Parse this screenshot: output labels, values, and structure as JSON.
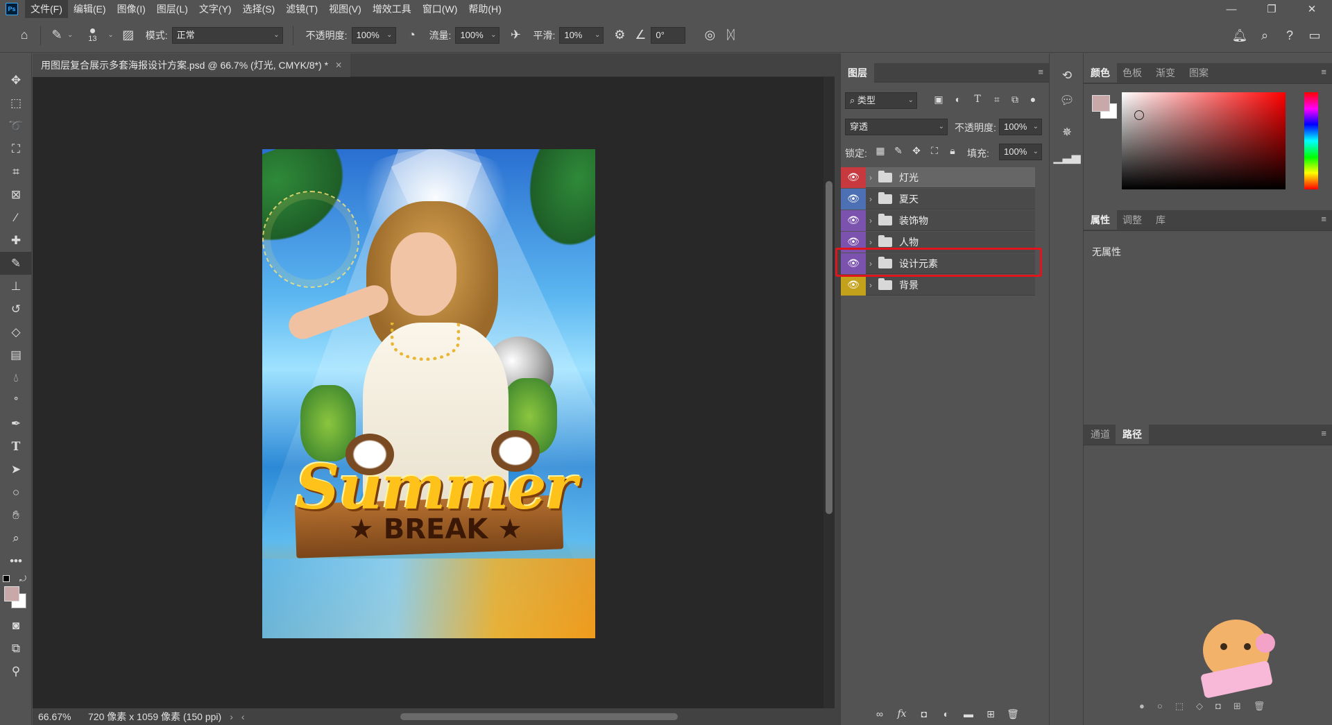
{
  "app": {
    "logo": "Ps"
  },
  "menubar": {
    "items": [
      "文件(F)",
      "编辑(E)",
      "图像(I)",
      "图层(L)",
      "文字(Y)",
      "选择(S)",
      "滤镜(T)",
      "视图(V)",
      "增效工具",
      "窗口(W)",
      "帮助(H)"
    ]
  },
  "options": {
    "brush_size": "13",
    "mode_label": "模式:",
    "mode_value": "正常",
    "opacity_label": "不透明度:",
    "opacity_value": "100%",
    "flow_label": "流量:",
    "flow_value": "100%",
    "smooth_label": "平滑:",
    "smooth_value": "10%",
    "angle_value": "0°"
  },
  "document": {
    "tab_title": "用图层复合展示多套海报设计方案.psd @ 66.7% (灯光, CMYK/8*) *",
    "zoom": "66.67%",
    "doc_info": "720 像素 x 1059 像素 (150 ppi)"
  },
  "poster": {
    "title": "Summer",
    "subtitle": "★ BREAK ★"
  },
  "layers_panel": {
    "tab": "图层",
    "filter_label": "类型",
    "blend_mode": "穿透",
    "opacity_label": "不透明度:",
    "opacity_value": "100%",
    "lock_label": "锁定:",
    "fill_label": "填充:",
    "fill_value": "100%",
    "layers": [
      {
        "name": "灯光",
        "color": "#c8393f"
      },
      {
        "name": "夏天",
        "color": "#4d6fb3"
      },
      {
        "name": "装饰物",
        "color": "#7b52ad"
      },
      {
        "name": "人物",
        "color": "#7b52ad"
      },
      {
        "name": "设计元素",
        "color": "#7b52ad"
      },
      {
        "name": "背景",
        "color": "#c4a11a"
      }
    ]
  },
  "color_panel": {
    "tabs": [
      "颜色",
      "色板",
      "渐变",
      "图案"
    ],
    "foreground": "#c8a8a9",
    "background": "#ffffff"
  },
  "properties_panel": {
    "tabs": [
      "属性",
      "调整",
      "库"
    ],
    "empty_text": "无属性"
  },
  "paths_panel": {
    "tabs": [
      "通道",
      "路径"
    ]
  }
}
